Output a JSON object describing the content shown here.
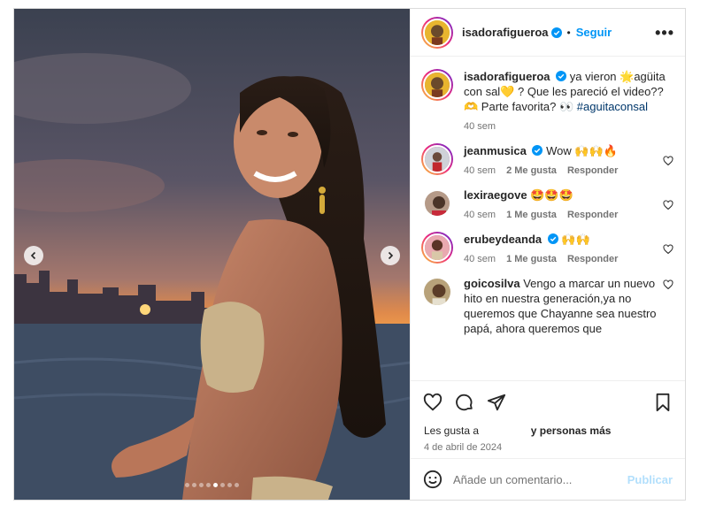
{
  "post": {
    "username": "isadorafigueroa",
    "follow_label": "Seguir",
    "separator": "•",
    "more_label": "•••",
    "caption": {
      "username": "isadorafigueroa",
      "text_a": "ya vieron 🌟agüita con sal💛 ? Que les pareció el video??",
      "text_b": "🫶 Parte favorita? 👀",
      "hashtag": "#aguitaconsal",
      "time": "40 sem"
    },
    "carousel": {
      "count": 8,
      "active_index": 4
    }
  },
  "comments": [
    {
      "username": "jeanmusica",
      "verified": true,
      "text": "Wow 🙌🙌🔥",
      "time": "40 sem",
      "likes": "2 Me gusta",
      "reply": "Responder"
    },
    {
      "username": "lexiraegove",
      "verified": false,
      "text": "🤩🤩🤩",
      "time": "40 sem",
      "likes": "1 Me gusta",
      "reply": "Responder"
    },
    {
      "username": "erubeydeanda",
      "verified": true,
      "text": "🙌🙌",
      "time": "40 sem",
      "likes": "1 Me gusta",
      "reply": "Responder"
    },
    {
      "username": "goicosilva",
      "verified": false,
      "text": "Vengo a marcar un nuevo hito en nuestra generación,ya no queremos que Chayanne sea nuestro papá, ahora queremos que"
    }
  ],
  "footer": {
    "likes_prefix": "Les gusta a",
    "likes_suffix": "y personas más",
    "date": "4 de abril de 2024",
    "comment_placeholder": "Añade un comentario...",
    "publish_label": "Publicar"
  },
  "colors": {
    "accent": "#0095f6",
    "publish_disabled": "#b2dffc",
    "hashtag": "#00376b"
  }
}
